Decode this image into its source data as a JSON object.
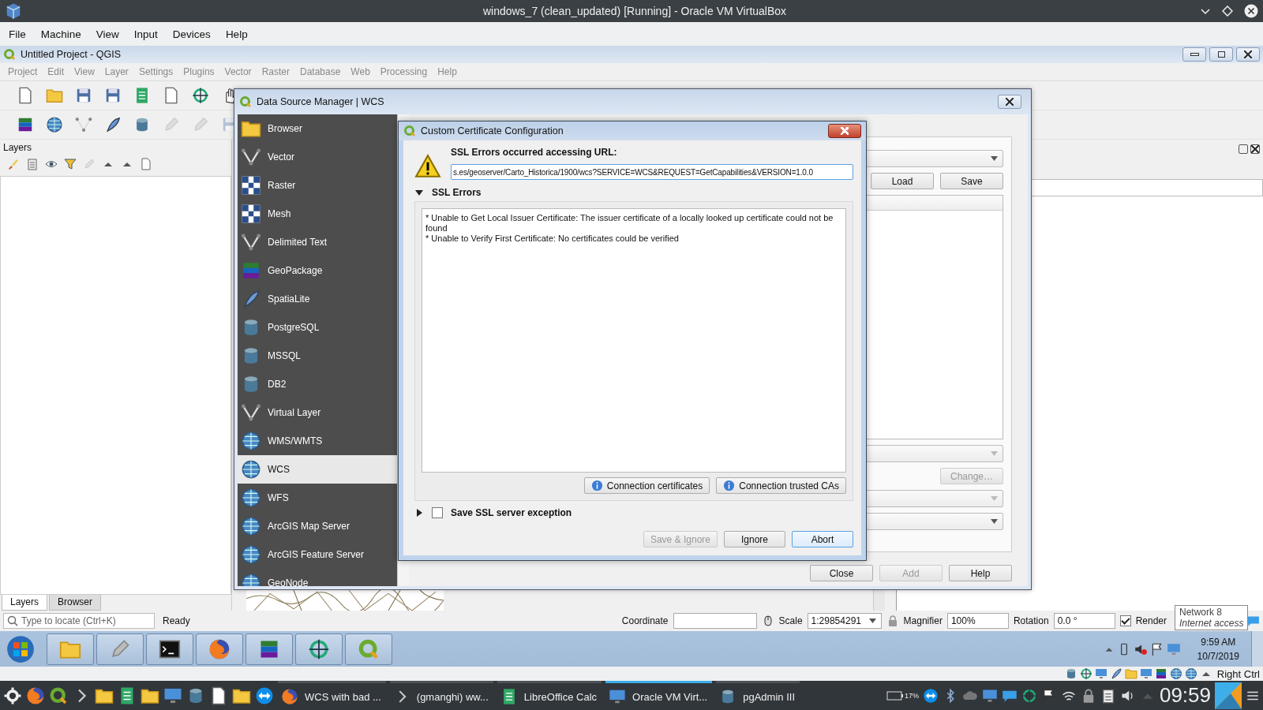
{
  "vbox": {
    "title": "windows_7 (clean_updated) [Running] - Oracle VM VirtualBox",
    "menu": [
      "File",
      "Machine",
      "View",
      "Input",
      "Devices",
      "Help"
    ],
    "host_key": "Right Ctrl"
  },
  "qgis": {
    "title": "Untitled Project - QGIS",
    "menu": [
      "Project",
      "Edit",
      "View",
      "Layer",
      "Settings",
      "Plugins",
      "Vector",
      "Raster",
      "Database",
      "Web",
      "Processing",
      "Help"
    ],
    "layers_panel": {
      "title": "Layers",
      "tabs": [
        {
          "label": "Layers",
          "selected": true
        },
        {
          "label": "Browser",
          "selected": false
        }
      ]
    },
    "status_bar": {
      "locate_placeholder": "Type to locate (Ctrl+K)",
      "message": "Ready",
      "coordinate_label": "Coordinate",
      "scale_label": "Scale",
      "scale": "1:29854291",
      "magnifier_label": "Magnifier",
      "magnifier": "100%",
      "rotation_label": "Rotation",
      "rotation": "0.0 °",
      "render": {
        "label": "Render",
        "checked": true
      }
    },
    "tooltip": {
      "title": "Network  8",
      "subtitle": "Internet access"
    }
  },
  "data_source_manager": {
    "title": "Data Source Manager | WCS",
    "sources": [
      {
        "label": "Browser",
        "selected": false
      },
      {
        "label": "Vector",
        "selected": false
      },
      {
        "label": "Raster",
        "selected": false
      },
      {
        "label": "Mesh",
        "selected": false
      },
      {
        "label": "Delimited Text",
        "selected": false
      },
      {
        "label": "GeoPackage",
        "selected": false
      },
      {
        "label": "SpatiaLite",
        "selected": false
      },
      {
        "label": "PostgreSQL",
        "selected": false
      },
      {
        "label": "MSSQL",
        "selected": false
      },
      {
        "label": "DB2",
        "selected": false
      },
      {
        "label": "Virtual Layer",
        "selected": false
      },
      {
        "label": "WMS/WMTS",
        "selected": false
      },
      {
        "label": "WCS",
        "selected": true
      },
      {
        "label": "WFS",
        "selected": false
      },
      {
        "label": "ArcGIS Map Server",
        "selected": false
      },
      {
        "label": "ArcGIS Feature Server",
        "selected": false
      },
      {
        "label": "GeoNode",
        "selected": false
      }
    ],
    "file_buttons": [
      {
        "label": "Load",
        "disabled": false
      },
      {
        "label": "Save",
        "disabled": false
      }
    ],
    "change_button": {
      "label": "Change…",
      "disabled": true
    },
    "footer_buttons": [
      {
        "label": "Close",
        "disabled": false
      },
      {
        "label": "Add",
        "disabled": true
      },
      {
        "label": "Help",
        "disabled": false
      }
    ]
  },
  "certificate_dialog": {
    "title": "Custom Certificate Configuration",
    "heading": "SSL Errors occurred accessing URL:",
    "url": "s.es/geoserver/Carto_Historica/1900/wcs?SERVICE=WCS&REQUEST=GetCapabilities&VERSION=1.0.0",
    "errors_section": {
      "label": "SSL Errors",
      "expanded": true
    },
    "errors": [
      "* Unable to Get Local Issuer Certificate: The issuer certificate of a locally looked up certificate could not be found",
      "* Unable to Verify First Certificate: No certificates could be verified"
    ],
    "info_buttons": [
      "Connection certificates",
      "Connection trusted CAs"
    ],
    "exception": {
      "label": "Save SSL server exception",
      "expanded": false,
      "checked": false
    },
    "buttons": [
      {
        "label": "Save & Ignore",
        "disabled": true,
        "default": false
      },
      {
        "label": "Ignore",
        "disabled": false,
        "default": false
      },
      {
        "label": "Abort",
        "disabled": false,
        "default": true
      }
    ]
  },
  "win7_taskbar": {
    "clock_time": "9:59 AM",
    "clock_date": "10/7/2019"
  },
  "kde_panel": {
    "tasks": [
      {
        "label": "WCS with bad ...",
        "active": false
      },
      {
        "label": "(gmanghi) ww...",
        "active": false
      },
      {
        "label": "LibreOffice Calc",
        "active": false
      },
      {
        "label": "Oracle VM Virt...",
        "active": true
      },
      {
        "label": "pgAdmin III",
        "active": false
      }
    ],
    "battery": "17%",
    "clock": "09:59"
  }
}
